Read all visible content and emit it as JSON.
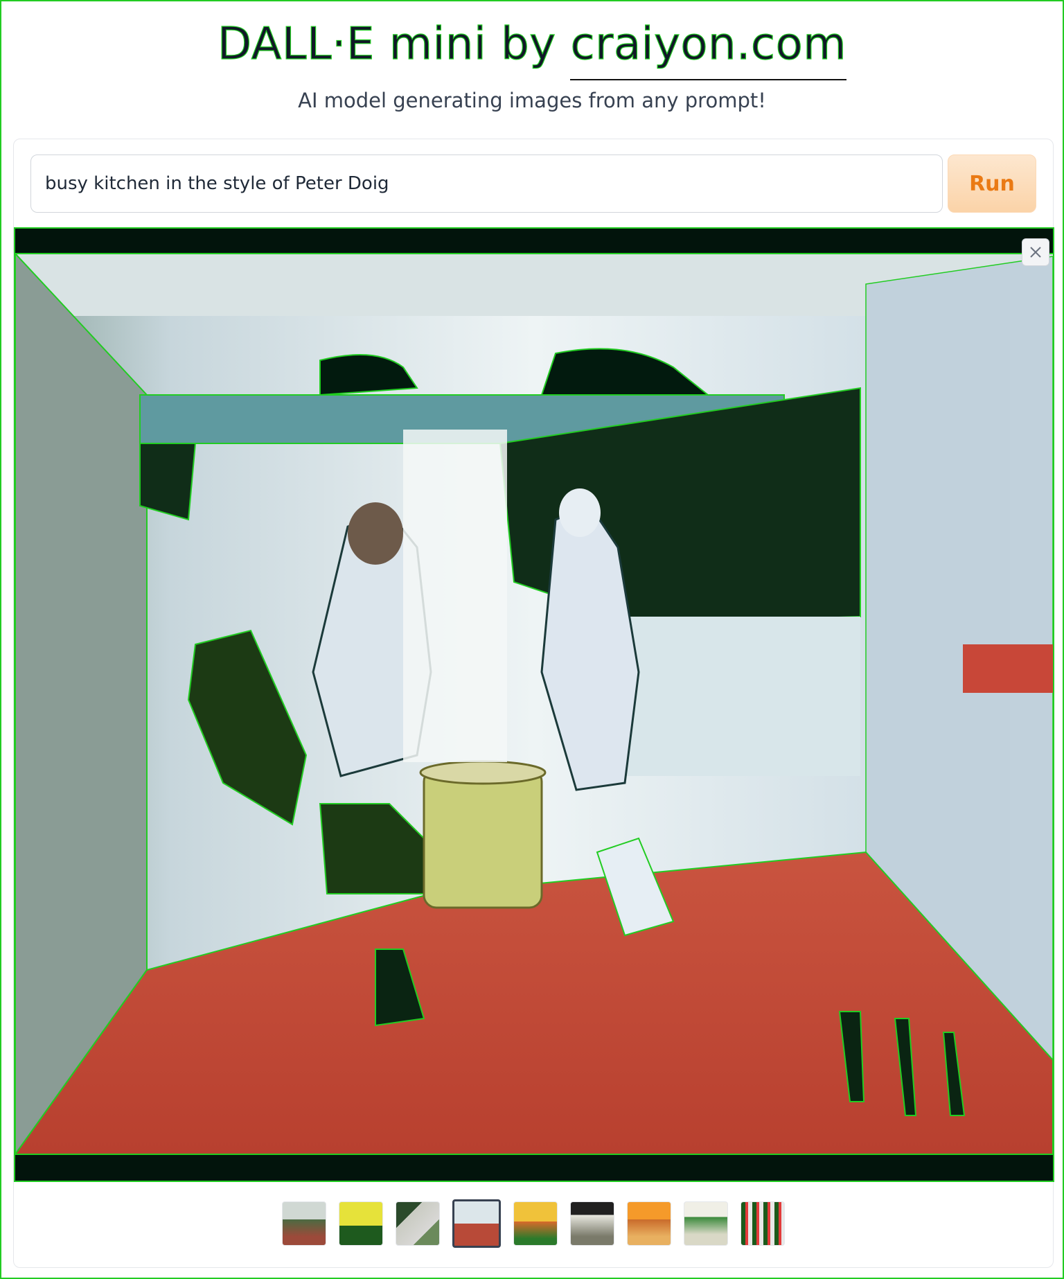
{
  "header": {
    "title_prefix": "DALL·E mini by ",
    "title_site": "craiyon.com",
    "subtitle": "AI model generating images from any prompt!"
  },
  "prompt": {
    "value": "busy kitchen in the style of Peter Doig",
    "placeholder": ""
  },
  "run_button": {
    "label": "Run"
  },
  "gallery": {
    "selected_index": 3,
    "close_icon": "close-icon",
    "thumbnail_count": 9
  },
  "colors": {
    "outline_green": "#22cc22",
    "run_text": "#ea7a14",
    "run_bg": "#fbd3a8"
  }
}
